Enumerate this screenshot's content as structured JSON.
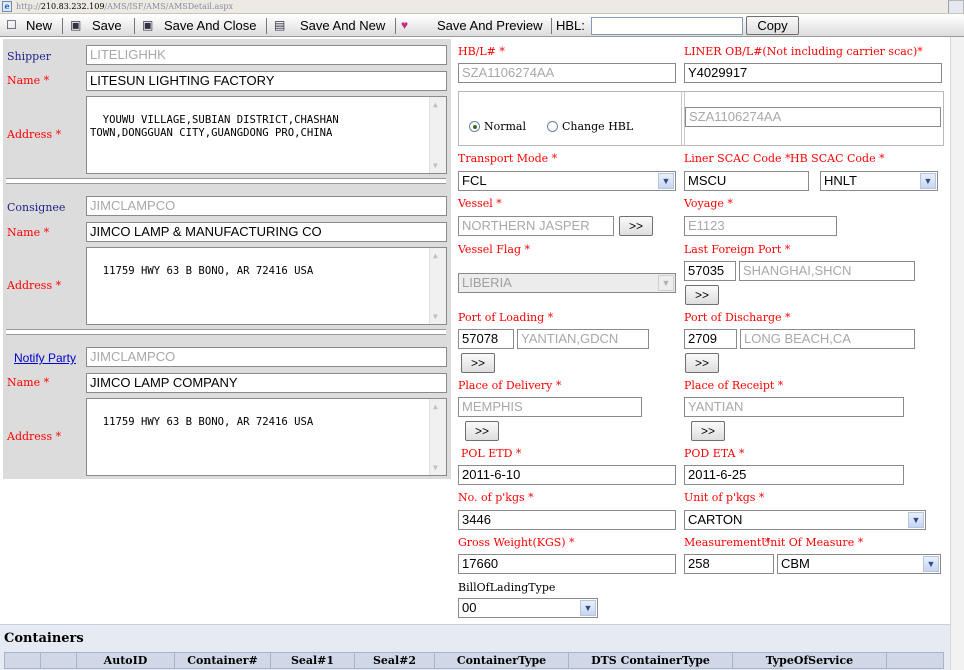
{
  "address_bar": {
    "prefix": "http://",
    "host": "210.83.232.109",
    "path": "/AMS/ISF/AMS/AMSDetail.aspx"
  },
  "toolbar": {
    "new": "New",
    "save": "Save",
    "save_close": "Save And Close",
    "save_new": "Save And New",
    "save_preview": "Save And Preview",
    "hbl_label": "HBL:",
    "hbl_value": "",
    "copy": "Copy"
  },
  "shipper": {
    "label": "Shipper",
    "code": "LITELIGHHK",
    "name_label": "Name *",
    "name": "LITESUN LIGHTING FACTORY",
    "address_label": "Address *",
    "address": "YOUWU VILLAGE,SUBIAN DISTRICT,CHASHAN\nTOWN,DONGGUAN CITY,GUANGDONG PRO,CHINA"
  },
  "consignee": {
    "label": "Consignee",
    "code": "JIMCLAMPCO",
    "name_label": "Name *",
    "name": "JIMCO LAMP & MANUFACTURING CO",
    "address_label": "Address *",
    "address": "11759 HWY 63 B BONO, AR 72416 USA"
  },
  "notify": {
    "label": "Notify Party",
    "code": "JIMCLAMPCO",
    "name_label": "Name *",
    "name": "JIMCO LAMP COMPANY",
    "address_label": "Address *",
    "address": "11759 HWY 63 B BONO, AR 72416 USA"
  },
  "right": {
    "hbl_label": "HB/L# *",
    "hbl": "SZA1106274AA",
    "liner_label": "LINER OB/L#(Not including carrier scac)*",
    "liner": "Y4029917",
    "radio_normal": "Normal",
    "radio_change": "Change HBL",
    "change_hbl_value": "SZA1106274AA",
    "transport_label": "Transport Mode *",
    "transport": "FCL",
    "liner_scac_label": "Liner SCAC Code *",
    "liner_scac": "MSCU",
    "hb_scac_label": "HB SCAC Code *",
    "hb_scac": "HNLT",
    "vessel_label": "Vessel *",
    "vessel": "NORTHERN JASPER",
    "btn_more": ">>",
    "voyage_label": "Voyage *",
    "voyage": "E1123",
    "flag_label": "Vessel Flag *",
    "flag": "LIBERIA",
    "last_port_label": "Last Foreign Port *",
    "last_port_code": "57035",
    "last_port": "SHANGHAI,SHCN",
    "pol_label": "Port of Loading *",
    "pol_code": "57078",
    "pol": "YANTIAN,GDCN",
    "pod_label": "Port of Discharge *",
    "pod_code": "2709",
    "pod": "LONG BEACH,CA",
    "delivery_label": "Place of Delivery *",
    "delivery": "MEMPHIS",
    "receipt_label": "Place of Receipt *",
    "receipt": "YANTIAN",
    "etd_label": "POL ETD *",
    "etd": "2011-6-10",
    "eta_label": "POD ETA *",
    "eta": "2011-6-25",
    "pkgs_label": "No. of p'kgs *",
    "pkgs": "3446",
    "unit_label": "Unit of p'kgs *",
    "unit": "CARTON",
    "weight_label": "Gross Weight(KGS) *",
    "weight": "17660",
    "measure_label": "Measurement *",
    "uom_label": "Unit Of Measure *",
    "measure": "258",
    "uom": "CBM",
    "bol_type_label": "BillOfLadingType",
    "bol_type": "00"
  },
  "containers": {
    "title": "Containers",
    "columns": [
      "",
      "",
      "AutoID",
      "Container#",
      "Seal#1",
      "Seal#2",
      "ContainerType",
      "DTS ContainerType",
      "TypeOfService"
    ]
  },
  "colors": {
    "required": "#ff0000",
    "label_blue": "#22228b",
    "panel": "#dcdcdc",
    "header_bg": "#e6ebf3"
  }
}
